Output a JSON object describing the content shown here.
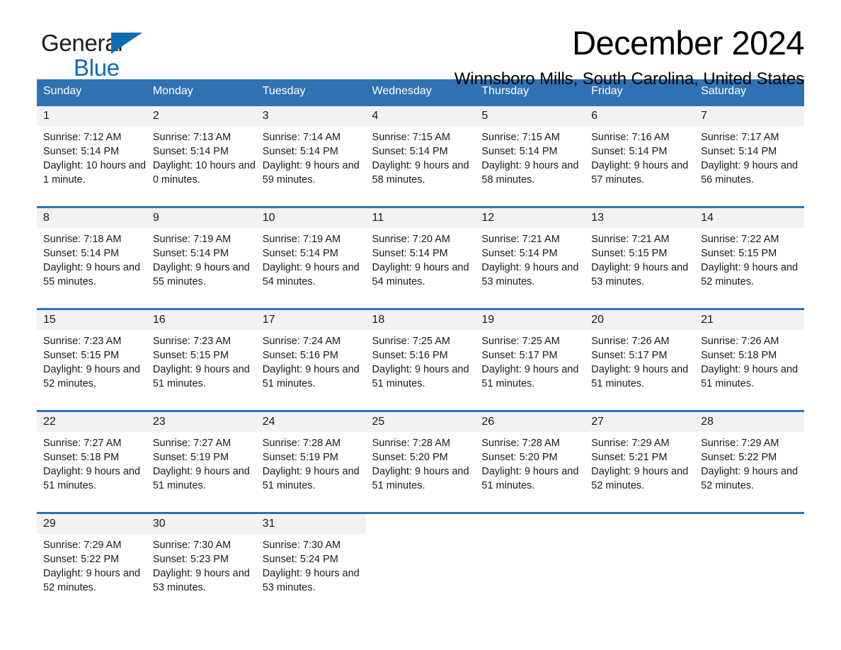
{
  "brand": {
    "name_part1": "General",
    "name_part2": "Blue",
    "accent_color": "#106cb0",
    "logo_icon": "triangle-flag-icon"
  },
  "header": {
    "title": "December 2024",
    "location": "Winnsboro Mills, South Carolina, United States"
  },
  "calendar": {
    "header_color": "#2f72b4",
    "daynum_band_color": "#f2f2f2",
    "weekdays": [
      "Sunday",
      "Monday",
      "Tuesday",
      "Wednesday",
      "Thursday",
      "Friday",
      "Saturday"
    ],
    "weeks": [
      [
        {
          "day": "1",
          "sunrise": "Sunrise: 7:12 AM",
          "sunset": "Sunset: 5:14 PM",
          "daylight": "Daylight: 10 hours and 1 minute."
        },
        {
          "day": "2",
          "sunrise": "Sunrise: 7:13 AM",
          "sunset": "Sunset: 5:14 PM",
          "daylight": "Daylight: 10 hours and 0 minutes."
        },
        {
          "day": "3",
          "sunrise": "Sunrise: 7:14 AM",
          "sunset": "Sunset: 5:14 PM",
          "daylight": "Daylight: 9 hours and 59 minutes."
        },
        {
          "day": "4",
          "sunrise": "Sunrise: 7:15 AM",
          "sunset": "Sunset: 5:14 PM",
          "daylight": "Daylight: 9 hours and 58 minutes."
        },
        {
          "day": "5",
          "sunrise": "Sunrise: 7:15 AM",
          "sunset": "Sunset: 5:14 PM",
          "daylight": "Daylight: 9 hours and 58 minutes."
        },
        {
          "day": "6",
          "sunrise": "Sunrise: 7:16 AM",
          "sunset": "Sunset: 5:14 PM",
          "daylight": "Daylight: 9 hours and 57 minutes."
        },
        {
          "day": "7",
          "sunrise": "Sunrise: 7:17 AM",
          "sunset": "Sunset: 5:14 PM",
          "daylight": "Daylight: 9 hours and 56 minutes."
        }
      ],
      [
        {
          "day": "8",
          "sunrise": "Sunrise: 7:18 AM",
          "sunset": "Sunset: 5:14 PM",
          "daylight": "Daylight: 9 hours and 55 minutes."
        },
        {
          "day": "9",
          "sunrise": "Sunrise: 7:19 AM",
          "sunset": "Sunset: 5:14 PM",
          "daylight": "Daylight: 9 hours and 55 minutes."
        },
        {
          "day": "10",
          "sunrise": "Sunrise: 7:19 AM",
          "sunset": "Sunset: 5:14 PM",
          "daylight": "Daylight: 9 hours and 54 minutes."
        },
        {
          "day": "11",
          "sunrise": "Sunrise: 7:20 AM",
          "sunset": "Sunset: 5:14 PM",
          "daylight": "Daylight: 9 hours and 54 minutes."
        },
        {
          "day": "12",
          "sunrise": "Sunrise: 7:21 AM",
          "sunset": "Sunset: 5:14 PM",
          "daylight": "Daylight: 9 hours and 53 minutes."
        },
        {
          "day": "13",
          "sunrise": "Sunrise: 7:21 AM",
          "sunset": "Sunset: 5:15 PM",
          "daylight": "Daylight: 9 hours and 53 minutes."
        },
        {
          "day": "14",
          "sunrise": "Sunrise: 7:22 AM",
          "sunset": "Sunset: 5:15 PM",
          "daylight": "Daylight: 9 hours and 52 minutes."
        }
      ],
      [
        {
          "day": "15",
          "sunrise": "Sunrise: 7:23 AM",
          "sunset": "Sunset: 5:15 PM",
          "daylight": "Daylight: 9 hours and 52 minutes."
        },
        {
          "day": "16",
          "sunrise": "Sunrise: 7:23 AM",
          "sunset": "Sunset: 5:15 PM",
          "daylight": "Daylight: 9 hours and 51 minutes."
        },
        {
          "day": "17",
          "sunrise": "Sunrise: 7:24 AM",
          "sunset": "Sunset: 5:16 PM",
          "daylight": "Daylight: 9 hours and 51 minutes."
        },
        {
          "day": "18",
          "sunrise": "Sunrise: 7:25 AM",
          "sunset": "Sunset: 5:16 PM",
          "daylight": "Daylight: 9 hours and 51 minutes."
        },
        {
          "day": "19",
          "sunrise": "Sunrise: 7:25 AM",
          "sunset": "Sunset: 5:17 PM",
          "daylight": "Daylight: 9 hours and 51 minutes."
        },
        {
          "day": "20",
          "sunrise": "Sunrise: 7:26 AM",
          "sunset": "Sunset: 5:17 PM",
          "daylight": "Daylight: 9 hours and 51 minutes."
        },
        {
          "day": "21",
          "sunrise": "Sunrise: 7:26 AM",
          "sunset": "Sunset: 5:18 PM",
          "daylight": "Daylight: 9 hours and 51 minutes."
        }
      ],
      [
        {
          "day": "22",
          "sunrise": "Sunrise: 7:27 AM",
          "sunset": "Sunset: 5:18 PM",
          "daylight": "Daylight: 9 hours and 51 minutes."
        },
        {
          "day": "23",
          "sunrise": "Sunrise: 7:27 AM",
          "sunset": "Sunset: 5:19 PM",
          "daylight": "Daylight: 9 hours and 51 minutes."
        },
        {
          "day": "24",
          "sunrise": "Sunrise: 7:28 AM",
          "sunset": "Sunset: 5:19 PM",
          "daylight": "Daylight: 9 hours and 51 minutes."
        },
        {
          "day": "25",
          "sunrise": "Sunrise: 7:28 AM",
          "sunset": "Sunset: 5:20 PM",
          "daylight": "Daylight: 9 hours and 51 minutes."
        },
        {
          "day": "26",
          "sunrise": "Sunrise: 7:28 AM",
          "sunset": "Sunset: 5:20 PM",
          "daylight": "Daylight: 9 hours and 51 minutes."
        },
        {
          "day": "27",
          "sunrise": "Sunrise: 7:29 AM",
          "sunset": "Sunset: 5:21 PM",
          "daylight": "Daylight: 9 hours and 52 minutes."
        },
        {
          "day": "28",
          "sunrise": "Sunrise: 7:29 AM",
          "sunset": "Sunset: 5:22 PM",
          "daylight": "Daylight: 9 hours and 52 minutes."
        }
      ],
      [
        {
          "day": "29",
          "sunrise": "Sunrise: 7:29 AM",
          "sunset": "Sunset: 5:22 PM",
          "daylight": "Daylight: 9 hours and 52 minutes."
        },
        {
          "day": "30",
          "sunrise": "Sunrise: 7:30 AM",
          "sunset": "Sunset: 5:23 PM",
          "daylight": "Daylight: 9 hours and 53 minutes."
        },
        {
          "day": "31",
          "sunrise": "Sunrise: 7:30 AM",
          "sunset": "Sunset: 5:24 PM",
          "daylight": "Daylight: 9 hours and 53 minutes."
        },
        {
          "day": "",
          "sunrise": "",
          "sunset": "",
          "daylight": ""
        },
        {
          "day": "",
          "sunrise": "",
          "sunset": "",
          "daylight": ""
        },
        {
          "day": "",
          "sunrise": "",
          "sunset": "",
          "daylight": ""
        },
        {
          "day": "",
          "sunrise": "",
          "sunset": "",
          "daylight": ""
        }
      ]
    ]
  }
}
